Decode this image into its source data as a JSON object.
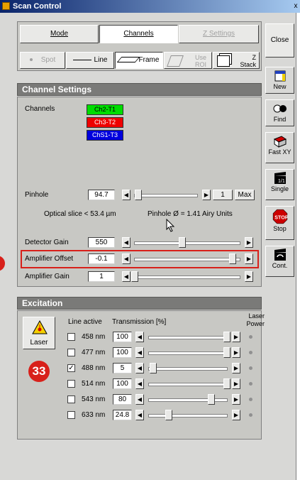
{
  "window": {
    "title": "Scan Control"
  },
  "tabs": [
    {
      "label": "Mode"
    },
    {
      "label": "Channels"
    },
    {
      "label": "Z Settings"
    }
  ],
  "scan_modes": [
    {
      "label": "Spot"
    },
    {
      "label": "Line"
    },
    {
      "label": "Frame"
    },
    {
      "label": "Use ROI"
    },
    {
      "label": "Z Stack"
    }
  ],
  "channel_settings": {
    "title": "Channel Settings",
    "channels_label": "Channels",
    "channels": [
      {
        "label": "Ch2-T1",
        "color": "#00dd00"
      },
      {
        "label": "Ch3-T2",
        "color": "#ee0000"
      },
      {
        "label": "ChS1-T3",
        "color": "#0000dd"
      }
    ],
    "pinhole": {
      "label": "Pinhole",
      "value": "94.7",
      "step": "1",
      "max_label": "Max",
      "level": 0.06
    },
    "optical_slice": "Optical slice < 53.4 µm",
    "pinhole_airy": "Pinhole Ø = 1.41 Airy Units",
    "detector_gain": {
      "label": "Detector Gain",
      "value": "550",
      "level": 0.45
    },
    "amplifier_offset": {
      "label": "Amplifier Offset",
      "value": "-0.1",
      "level": 0.93
    },
    "amplifier_gain": {
      "label": "Amplifier Gain",
      "value": "1",
      "level": 0.0
    }
  },
  "excitation": {
    "title": "Excitation",
    "laser_button": "Laser",
    "col_line_active": "Line active",
    "col_transmission": "Transmission [%]",
    "col_laser_power": "Laser Power",
    "lines": [
      {
        "nm": "458 nm",
        "checked": false,
        "value": "100",
        "level": 1.0
      },
      {
        "nm": "477 nm",
        "checked": false,
        "value": "100",
        "level": 1.0
      },
      {
        "nm": "488 nm",
        "checked": true,
        "value": "5",
        "level": 0.05
      },
      {
        "nm": "514 nm",
        "checked": false,
        "value": "100",
        "level": 1.0
      },
      {
        "nm": "543 nm",
        "checked": false,
        "value": "80",
        "level": 0.8
      },
      {
        "nm": "633 nm",
        "checked": false,
        "value": "24.8",
        "level": 0.25
      }
    ]
  },
  "sidebar": {
    "close": "Close",
    "new": "New",
    "find": "Find",
    "fast_xy": "Fast XY",
    "single": "Single",
    "stop": "Stop",
    "cont": "Cont."
  },
  "annotations": {
    "callout_number": "33"
  },
  "colors": {
    "highlight_box": "#d8201a",
    "section_bar": "#7a7a78",
    "stop_red": "#cc0000"
  }
}
